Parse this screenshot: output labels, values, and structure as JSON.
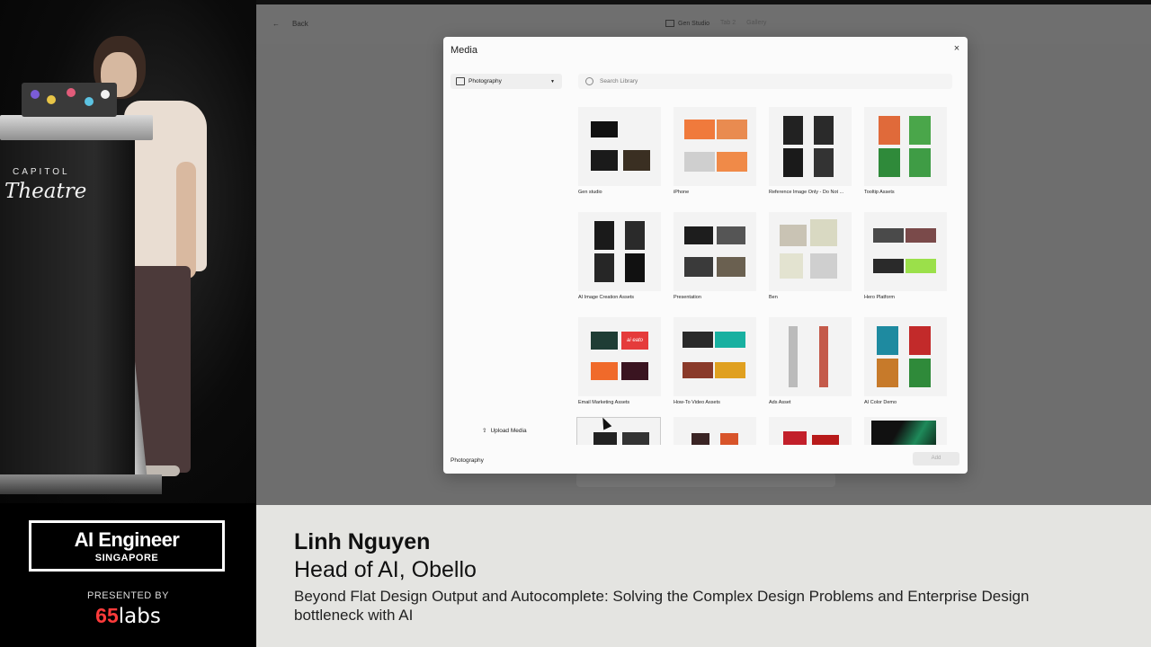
{
  "venue": {
    "line1": "CAPITOL",
    "line2": "Theatre"
  },
  "app": {
    "back_label": "Back",
    "tabs": [
      {
        "label": "Gen Studio",
        "active": true
      },
      {
        "label": "Tab 2",
        "active": false
      },
      {
        "label": "Gallery",
        "active": false
      }
    ]
  },
  "modal": {
    "title": "Media",
    "close_glyph": "×",
    "source_selected": "Photography",
    "search_placeholder": "Search Library",
    "upload_label": "Upload Media",
    "footer_label": "Photography",
    "add_label": "Add",
    "albums": [
      {
        "name": "Gen studio"
      },
      {
        "name": "iPhone"
      },
      {
        "name": "Reference Image Only - Do Not ..."
      },
      {
        "name": "Tooltip Assets"
      },
      {
        "name": "AI Image Creation Assets"
      },
      {
        "name": "Presentation"
      },
      {
        "name": "Ben"
      },
      {
        "name": "Hero Platform"
      },
      {
        "name": "Email Marketing Assets"
      },
      {
        "name": "How-To Video Assets"
      },
      {
        "name": "Ads Asset"
      },
      {
        "name": "AI Color Demo"
      },
      {
        "name": ""
      },
      {
        "name": ""
      },
      {
        "name": ""
      },
      {
        "name": ""
      }
    ],
    "email_logo": "ai eato"
  },
  "event": {
    "name": "AI Engineer",
    "city": "SINGAPORE",
    "presented_by": "PRESENTED BY",
    "sponsor_number": "65",
    "sponsor_word": "labs"
  },
  "speaker": {
    "name": "Linh Nguyen",
    "title": "Head of AI, Obello",
    "talk": "Beyond Flat Design Output and Autocomplete: Solving the Complex Design Problems and Enterprise Design bottleneck with AI"
  },
  "colors": {
    "sponsor_red": "#ff3b3b",
    "caption_bg": "#e4e4e1",
    "accent_orange": "#f07a3c"
  }
}
